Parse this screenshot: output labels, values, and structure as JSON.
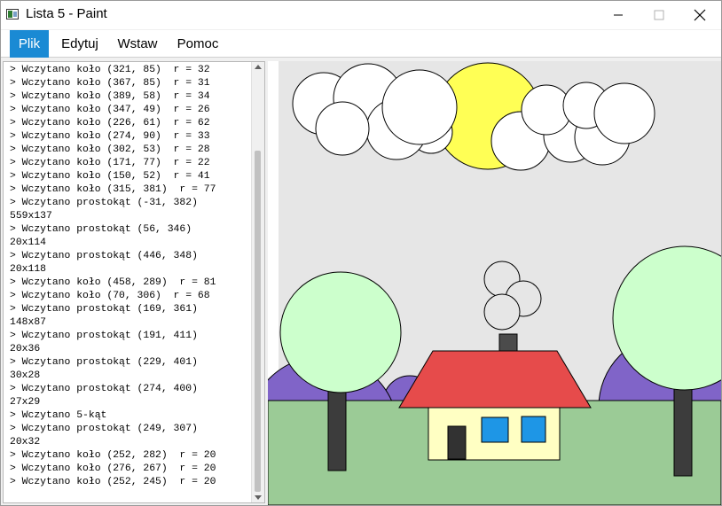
{
  "window": {
    "title": "Lista 5 - Paint",
    "controls": {
      "minimize": "minimize-icon",
      "maximize": "maximize-icon",
      "close": "close-icon"
    }
  },
  "menu": {
    "items": [
      {
        "label": "Plik",
        "active": true
      },
      {
        "label": "Edytuj",
        "active": false
      },
      {
        "label": "Wstaw",
        "active": false
      },
      {
        "label": "Pomoc",
        "active": false
      }
    ],
    "accent_color": "#1a8ad4"
  },
  "log": {
    "lines": [
      "> Wczytano koło (321, 85)  r = 32",
      "> Wczytano koło (367, 85)  r = 31",
      "> Wczytano koło (389, 58)  r = 34",
      "> Wczytano koło (347, 49)  r = 26",
      "> Wczytano koło (226, 61)  r = 62",
      "> Wczytano koło (274, 90)  r = 33",
      "> Wczytano koło (302, 53)  r = 28",
      "> Wczytano koło (171, 77)  r = 22",
      "> Wczytano koło (150, 52)  r = 41",
      "> Wczytano koło (315, 381)  r = 77",
      "> Wczytano prostokąt (-31, 382)",
      "559x137",
      "> Wczytano prostokąt (56, 346)",
      "20x114",
      "> Wczytano prostokąt (446, 348)",
      "20x118",
      "> Wczytano koło (458, 289)  r = 81",
      "> Wczytano koło (70, 306)  r = 68",
      "> Wczytano prostokąt (169, 361)",
      "148x87",
      "> Wczytano prostokąt (191, 411)",
      "20x36",
      "> Wczytano prostokąt (229, 401)",
      "30x28",
      "> Wczytano prostokąt (274, 400)",
      "27x29",
      "> Wczytano 5-kąt",
      "> Wczytano prostokąt (249, 307)",
      "20x32",
      "> Wczytano koło (252, 282)  r = 20",
      "> Wczytano koło (276, 267)  r = 20",
      "> Wczytano koło (252, 245)  r = 20"
    ]
  },
  "colors": {
    "sky": "#e6e6e6",
    "sun": "#ffff55",
    "cloud": "#ffffff",
    "hills": "#8064c8",
    "grass": "#9bcb96",
    "tree_crown": "#ccffcc",
    "tree_trunk": "#3c3c3c",
    "roof": "#e64b4b",
    "house_wall": "#ffffc3",
    "window": "#1e96e6",
    "door": "#323232",
    "chimney": "#4b4b4b",
    "smoke": "#e6e6e6"
  }
}
